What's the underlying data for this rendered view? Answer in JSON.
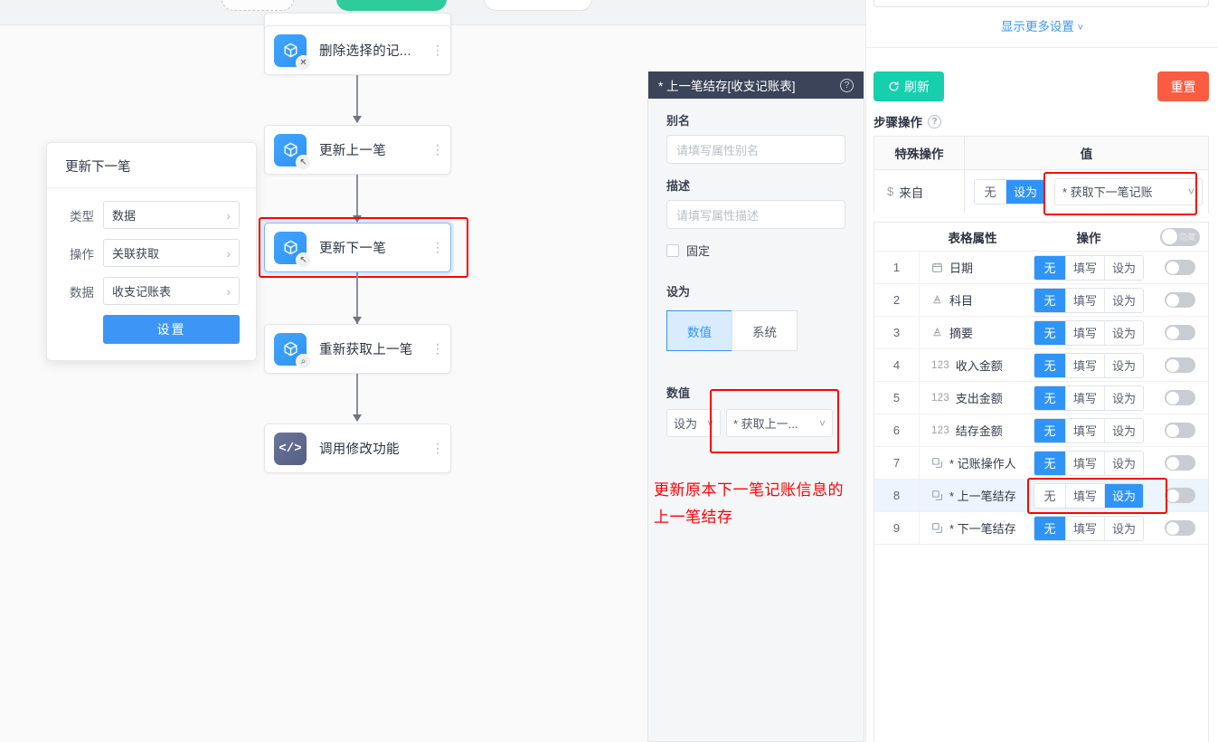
{
  "top_strip": {
    "chip_dashed": "",
    "chip_green": "",
    "chip_plain": ""
  },
  "canvas": {
    "nodes": [
      {
        "label": "",
        "icon": "cube-icon",
        "badge": "",
        "kind": "data",
        "clipped": true
      },
      {
        "label": "删除选择的记...",
        "icon": "cube-icon",
        "badge": "✕",
        "kind": "data"
      },
      {
        "label": "更新上一笔",
        "icon": "cube-icon",
        "badge": "↖",
        "kind": "data"
      },
      {
        "label": "更新下一笔",
        "icon": "cube-icon",
        "badge": "↖",
        "kind": "data"
      },
      {
        "label": "重新获取上一笔",
        "icon": "cube-icon",
        "badge": "⌕",
        "kind": "data"
      },
      {
        "label": "调用修改功能",
        "icon": "code-icon",
        "badge": "",
        "kind": "code"
      }
    ]
  },
  "popup": {
    "title": "更新下一笔",
    "rows": [
      {
        "label": "类型",
        "value": "数据"
      },
      {
        "label": "操作",
        "value": "关联获取"
      },
      {
        "label": "数据",
        "value": "收支记账表"
      }
    ],
    "submit": "设置"
  },
  "mid_panel": {
    "header_title": "* 上一笔结存[收支记账表]",
    "help_icon": "question-mark-icon",
    "alias_label": "别名",
    "alias_placeholder": "请填写属性别名",
    "desc_label": "描述",
    "desc_placeholder": "请填写属性描述",
    "fixed_label": "固定",
    "setas_label": "设为",
    "segments": [
      {
        "label": "数值",
        "active": true
      },
      {
        "label": "系统",
        "active": false
      }
    ],
    "value_label": "数值",
    "value_mode": "设为",
    "value_source": "* 获取上一...",
    "note": "更新原本下一笔记账信息的\n上一笔结存"
  },
  "right_panel": {
    "show_more": "显示更多设置",
    "refresh_label": "刷新",
    "refresh_icon": "refresh-icon",
    "reset_label": "重置",
    "step_title": "步骤操作",
    "step_help_icon": "question-mark-icon",
    "op_table": {
      "headers": [
        "特殊操作",
        "值"
      ],
      "row": {
        "name": "来自",
        "name_icon": "dollar-icon",
        "pills": [
          {
            "label": "无",
            "on": false
          },
          {
            "label": "设为",
            "on": true
          }
        ],
        "value": "* 获取下一笔记账",
        "chevron": "chevron-down-icon"
      }
    },
    "prop_table": {
      "headers": {
        "index": "",
        "name": "表格属性",
        "ops": "操作",
        "toggle_text": "隐藏"
      },
      "rows": [
        {
          "index": "1",
          "icon": "calendar-icon",
          "name": "日期",
          "pills": [
            {
              "label": "无",
              "on": true
            },
            {
              "label": "填写",
              "on": false
            },
            {
              "label": "设为",
              "on": false
            }
          ],
          "toggle": false,
          "highlight": false
        },
        {
          "index": "2",
          "icon": "text-icon",
          "name": "科目",
          "pills": [
            {
              "label": "无",
              "on": true
            },
            {
              "label": "填写",
              "on": false
            },
            {
              "label": "设为",
              "on": false
            }
          ],
          "toggle": false,
          "highlight": false
        },
        {
          "index": "3",
          "icon": "text-icon",
          "name": "摘要",
          "pills": [
            {
              "label": "无",
              "on": true
            },
            {
              "label": "填写",
              "on": false
            },
            {
              "label": "设为",
              "on": false
            }
          ],
          "toggle": false,
          "highlight": false
        },
        {
          "index": "4",
          "icon": "number-icon",
          "name": "收入金额",
          "pills": [
            {
              "label": "无",
              "on": true
            },
            {
              "label": "填写",
              "on": false
            },
            {
              "label": "设为",
              "on": false
            }
          ],
          "toggle": false,
          "highlight": false
        },
        {
          "index": "5",
          "icon": "number-icon",
          "name": "支出金额",
          "pills": [
            {
              "label": "无",
              "on": true
            },
            {
              "label": "填写",
              "on": false
            },
            {
              "label": "设为",
              "on": false
            }
          ],
          "toggle": false,
          "highlight": false
        },
        {
          "index": "6",
          "icon": "number-icon",
          "name": "结存金额",
          "pills": [
            {
              "label": "无",
              "on": true
            },
            {
              "label": "填写",
              "on": false
            },
            {
              "label": "设为",
              "on": false
            }
          ],
          "toggle": false,
          "highlight": false
        },
        {
          "index": "7",
          "icon": "relation-icon",
          "name": "* 记账操作人",
          "pills": [
            {
              "label": "无",
              "on": true
            },
            {
              "label": "填写",
              "on": false
            },
            {
              "label": "设为",
              "on": false
            }
          ],
          "toggle": false,
          "highlight": false
        },
        {
          "index": "8",
          "icon": "relation-icon",
          "name": "* 上一笔结存",
          "pills": [
            {
              "label": "无",
              "on": false
            },
            {
              "label": "填写",
              "on": false
            },
            {
              "label": "设为",
              "on": true
            }
          ],
          "toggle": false,
          "highlight": true
        },
        {
          "index": "9",
          "icon": "relation-icon",
          "name": "* 下一笔结存",
          "pills": [
            {
              "label": "无",
              "on": true
            },
            {
              "label": "填写",
              "on": false
            },
            {
              "label": "设为",
              "on": false
            }
          ],
          "toggle": false,
          "highlight": false
        }
      ]
    }
  },
  "colors": {
    "accent_blue": "#2f94f7",
    "link_blue": "#3d96f5",
    "refresh_teal": "#16cfad",
    "reset_red": "#fa5c42",
    "annotation_red": "#ff0000",
    "panel_header_dark": "#3b4458",
    "node_icon_blue": "#41a4ff",
    "node_icon_slate": "#6b7499",
    "selected_row_bg": "#ecf5fd"
  }
}
